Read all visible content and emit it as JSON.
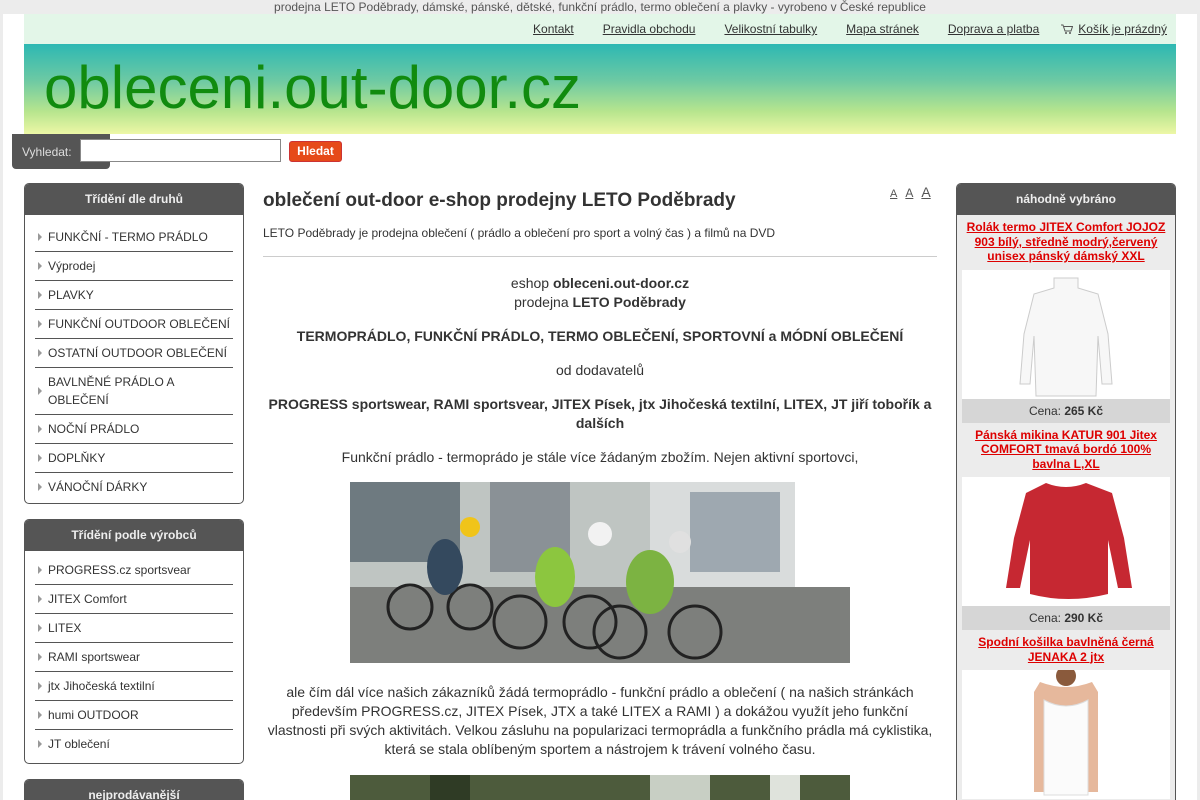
{
  "topline": "prodejna LETO Poděbrady, dámské, pánské, dětské, funkční prádlo, termo oblečení a plavky - vyrobeno v České republice",
  "nav": {
    "items": [
      "Kontakt",
      "Pravidla obchodu",
      "Velikostní tabulky",
      "Mapa stránek",
      "Doprava a platba"
    ],
    "cart": "Košík je prázdný",
    "cart_icon": "cart-icon"
  },
  "logo": "obleceni.out-door.cz",
  "search": {
    "label": "Vyhledat:",
    "value": "",
    "button": "Hledat"
  },
  "colors": {
    "logo": "#118b0f",
    "accent": "#e64a19",
    "product_link": "#dd0000",
    "panel_head": "#555555"
  },
  "sidebar": {
    "categories": {
      "title": "Třídění dle druhů",
      "items": [
        "FUNKČNÍ - TERMO PRÁDLO",
        "Výprodej",
        "PLAVKY",
        "FUNKČNÍ OUTDOOR OBLEČENÍ",
        "OSTATNÍ OUTDOOR OBLEČENÍ",
        "BAVLNĚNÉ PRÁDLO A OBLEČENÍ",
        "NOČNÍ PRÁDLO",
        "DOPLŇKY",
        "VÁNOČNÍ DÁRKY"
      ]
    },
    "brands": {
      "title": "Třídění podle výrobců",
      "items": [
        "PROGRESS.cz sportsvear",
        "JITEX Comfort",
        "LITEX",
        "RAMI sportswear",
        "jtx Jihočeská textilní",
        "humi OUTDOOR",
        "JT oblečení"
      ]
    },
    "bestsellers": {
      "title": "nejprodávanější"
    }
  },
  "main": {
    "font_sizes": [
      "A",
      "A",
      "A"
    ],
    "title": "oblečení out-door e-shop prodejny LETO Poděbrady",
    "intro": "LETO Poděbrady je prodejna oblečení ( prádlo a oblečení pro sport a volný čas ) a filmů na DVD",
    "eshop_prefix": "eshop",
    "eshop_name": "obleceni.out-door.cz",
    "shop_prefix": "prodejna",
    "shop_name": "LETO Poděbrady",
    "headline": "TERMOPRÁDLO, FUNKČNÍ PRÁDLO, TERMO OBLEČENÍ, SPORTOVNÍ a MÓDNÍ OBLEČENÍ",
    "supplier_line": "od dodavatelů",
    "suppliers": "PROGRESS sportswear, RAMI sportsvear, JITEX Písek, jtx Jihočeská textilní, LITEX, JT jiří tobořík a dalších",
    "paragraph1": "Funkční prádlo - termoprádo je stále více žádaným zbožím. Nejen aktivní sportovci,",
    "paragraph2": "ale čím dál více našich zákazníků žádá termoprádlo - funkční prádlo a oblečení ( na našich stránkách především PROGRESS.cz, JITEX Písek, JTX a také LITEX a RAMI ) a dokážou využít jeho funkční vlastnosti při svých aktivitách. Velkou zásluhu na popularizaci termoprádla a funkčního prádla má cyklistika, která se stala oblíbeným sportem a nástrojem k trávení volného času."
  },
  "random": {
    "title": "náhodně vybráno",
    "price_label": "Cena:",
    "products": [
      {
        "name": "Rolák termo JITEX Comfort JOJOZ 903 bílý, středně modrý,červený unisex pánský dámský XXL",
        "price": "265 Kč"
      },
      {
        "name": "Pánská mikina KATUR 901 Jitex COMFORT tmavá bordó 100% bavlna L,XL",
        "price": "290 Kč"
      },
      {
        "name": "Spodní košilka bavlněná černá JENAKA 2 jtx",
        "price": ""
      }
    ]
  }
}
